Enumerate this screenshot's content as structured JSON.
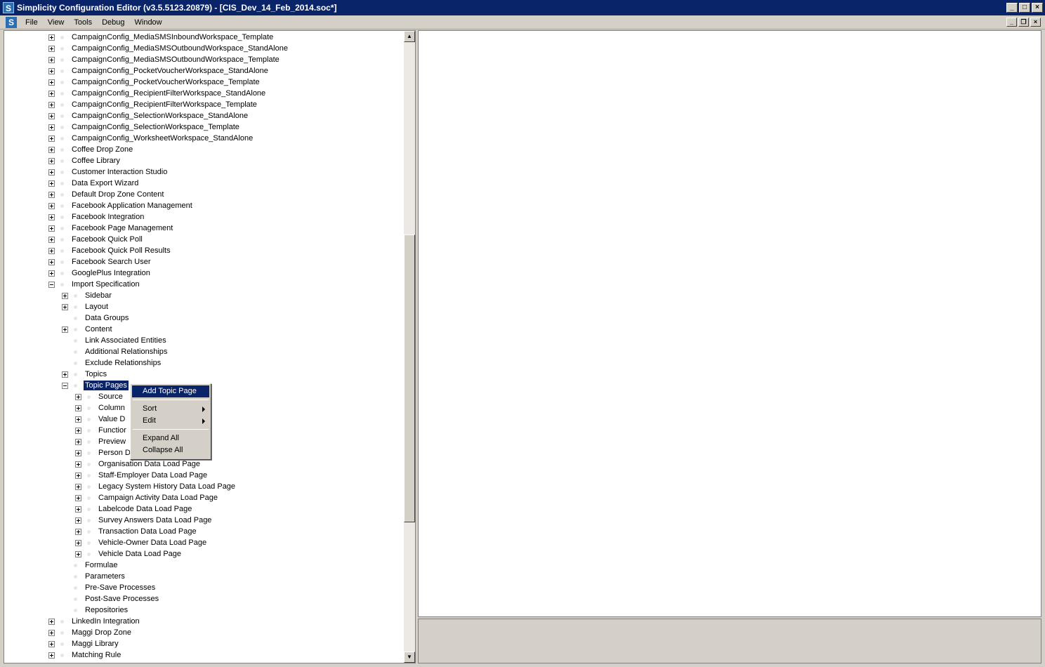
{
  "window": {
    "title": "Simplicity Configuration Editor (v3.5.5123.20879) - [CIS_Dev_14_Feb_2014.soc*]",
    "app_icon_glyph": "S",
    "minimize": "_",
    "maximize": "□",
    "close": "×"
  },
  "menubar": {
    "items": [
      "File",
      "View",
      "Tools",
      "Debug",
      "Window"
    ],
    "mdi_min": "_",
    "mdi_restore": "❐",
    "mdi_close": "×"
  },
  "tree": {
    "nodes": [
      {
        "label": "CampaignConfig_MediaSMSInboundWorkspace_Template",
        "level": 0,
        "expander": "plus"
      },
      {
        "label": "CampaignConfig_MediaSMSOutboundWorkspace_StandAlone",
        "level": 0,
        "expander": "plus"
      },
      {
        "label": "CampaignConfig_MediaSMSOutboundWorkspace_Template",
        "level": 0,
        "expander": "plus"
      },
      {
        "label": "CampaignConfig_PocketVoucherWorkspace_StandAlone",
        "level": 0,
        "expander": "plus"
      },
      {
        "label": "CampaignConfig_PocketVoucherWorkspace_Template",
        "level": 0,
        "expander": "plus"
      },
      {
        "label": "CampaignConfig_RecipientFilterWorkspace_StandAlone",
        "level": 0,
        "expander": "plus"
      },
      {
        "label": "CampaignConfig_RecipientFilterWorkspace_Template",
        "level": 0,
        "expander": "plus"
      },
      {
        "label": "CampaignConfig_SelectionWorkspace_StandAlone",
        "level": 0,
        "expander": "plus"
      },
      {
        "label": "CampaignConfig_SelectionWorkspace_Template",
        "level": 0,
        "expander": "plus"
      },
      {
        "label": "CampaignConfig_WorksheetWorkspace_StandAlone",
        "level": 0,
        "expander": "plus"
      },
      {
        "label": "Coffee Drop Zone",
        "level": 0,
        "expander": "plus"
      },
      {
        "label": "Coffee Library",
        "level": 0,
        "expander": "plus"
      },
      {
        "label": "Customer Interaction Studio",
        "level": 0,
        "expander": "plus"
      },
      {
        "label": "Data Export Wizard",
        "level": 0,
        "expander": "plus"
      },
      {
        "label": "Default Drop Zone Content",
        "level": 0,
        "expander": "plus"
      },
      {
        "label": "Facebook Application Management",
        "level": 0,
        "expander": "plus"
      },
      {
        "label": "Facebook Integration",
        "level": 0,
        "expander": "plus"
      },
      {
        "label": "Facebook Page Management",
        "level": 0,
        "expander": "plus"
      },
      {
        "label": "Facebook Quick Poll",
        "level": 0,
        "expander": "plus"
      },
      {
        "label": "Facebook Quick Poll Results",
        "level": 0,
        "expander": "plus"
      },
      {
        "label": "Facebook Search User",
        "level": 0,
        "expander": "plus"
      },
      {
        "label": "GooglePlus Integration",
        "level": 0,
        "expander": "plus"
      },
      {
        "label": "Import Specification",
        "level": 0,
        "expander": "minus"
      },
      {
        "label": "Sidebar",
        "level": 1,
        "expander": "plus"
      },
      {
        "label": "Layout",
        "level": 1,
        "expander": "plus"
      },
      {
        "label": "Data Groups",
        "level": 1,
        "expander": "none"
      },
      {
        "label": "Content",
        "level": 1,
        "expander": "plus"
      },
      {
        "label": "Link Associated Entities",
        "level": 1,
        "expander": "none"
      },
      {
        "label": "Additional Relationships",
        "level": 1,
        "expander": "none"
      },
      {
        "label": "Exclude Relationships",
        "level": 1,
        "expander": "none"
      },
      {
        "label": "Topics",
        "level": 1,
        "expander": "plus"
      },
      {
        "label": "Topic Pages",
        "level": 1,
        "expander": "minus",
        "selected": true
      },
      {
        "label": "Source",
        "level": 2,
        "expander": "plus"
      },
      {
        "label": "Column",
        "level": 2,
        "expander": "plus"
      },
      {
        "label": "Value D",
        "level": 2,
        "expander": "plus"
      },
      {
        "label": "Functior",
        "level": 2,
        "expander": "plus"
      },
      {
        "label": "Preview",
        "level": 2,
        "expander": "plus"
      },
      {
        "label": "Person D",
        "level": 2,
        "expander": "plus"
      },
      {
        "label": "Organisation Data Load Page",
        "level": 2,
        "expander": "plus"
      },
      {
        "label": "Staff-Employer Data Load Page",
        "level": 2,
        "expander": "plus"
      },
      {
        "label": "Legacy System History Data Load Page",
        "level": 2,
        "expander": "plus"
      },
      {
        "label": "Campaign Activity Data Load Page",
        "level": 2,
        "expander": "plus"
      },
      {
        "label": "Labelcode Data Load Page",
        "level": 2,
        "expander": "plus"
      },
      {
        "label": "Survey Answers Data Load Page",
        "level": 2,
        "expander": "plus"
      },
      {
        "label": "Transaction Data Load Page",
        "level": 2,
        "expander": "plus"
      },
      {
        "label": "Vehicle-Owner Data Load Page",
        "level": 2,
        "expander": "plus"
      },
      {
        "label": "Vehicle Data Load Page",
        "level": 2,
        "expander": "plus"
      },
      {
        "label": "Formulae",
        "level": 1,
        "expander": "none"
      },
      {
        "label": "Parameters",
        "level": 1,
        "expander": "none"
      },
      {
        "label": "Pre-Save Processes",
        "level": 1,
        "expander": "none"
      },
      {
        "label": "Post-Save Processes",
        "level": 1,
        "expander": "none"
      },
      {
        "label": "Repositories",
        "level": 1,
        "expander": "none"
      },
      {
        "label": "LinkedIn Integration",
        "level": 0,
        "expander": "plus"
      },
      {
        "label": "Maggi Drop Zone",
        "level": 0,
        "expander": "plus"
      },
      {
        "label": "Maggi Library",
        "level": 0,
        "expander": "plus"
      },
      {
        "label": "Matching Rule",
        "level": 0,
        "expander": "plus"
      }
    ]
  },
  "context_menu": {
    "add_topic_page": "Add Topic Page",
    "sort": "Sort",
    "edit": "Edit",
    "expand_all": "Expand All",
    "collapse_all": "Collapse All"
  },
  "scrollbar": {
    "up_arrow": "▲",
    "down_arrow": "▼"
  },
  "colors": {
    "selection": "#0a246a",
    "titlebar": "#0a246a",
    "chrome": "#d4d0c8"
  }
}
